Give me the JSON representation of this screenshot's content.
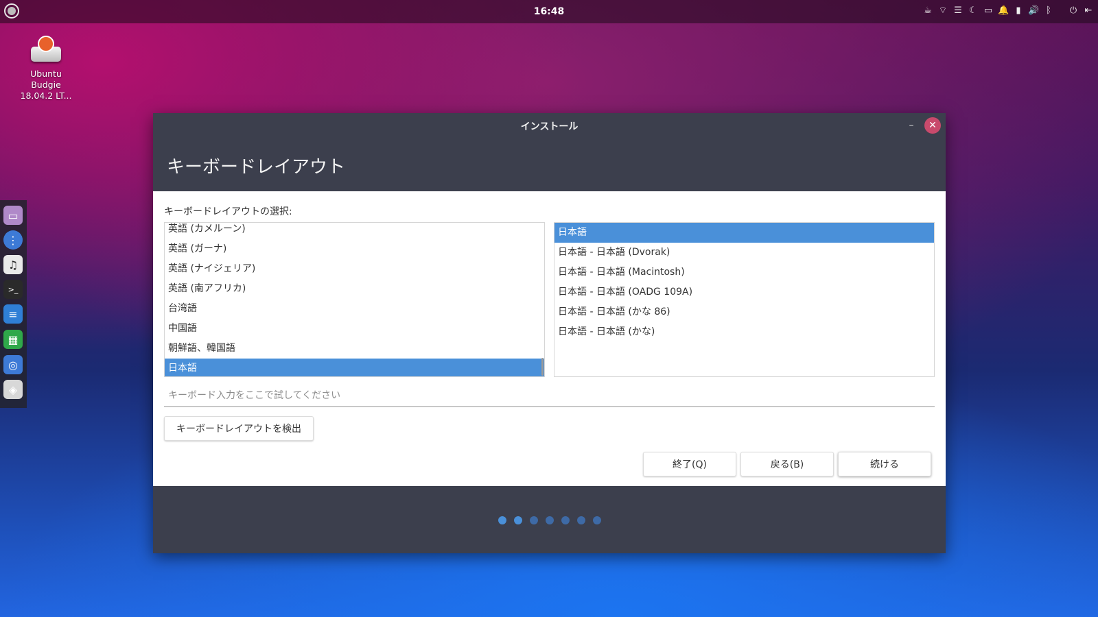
{
  "topbar": {
    "clock": "16:48",
    "tray_icons": [
      "coffee-icon",
      "wifi-icon",
      "menu-icon",
      "night-light-icon",
      "folder-icon",
      "notification-icon",
      "battery-icon",
      "volume-icon",
      "bluetooth-icon",
      "power-icon",
      "logout-icon"
    ]
  },
  "desktop": {
    "icon_label_line1": "Ubuntu",
    "icon_label_line2": "Budgie",
    "icon_label_line3": "18.04.2 LT..."
  },
  "dock": {
    "items": [
      "files-icon",
      "app-menu-icon",
      "music-icon",
      "terminal-icon",
      "writer-icon",
      "calc-icon",
      "chrome-icon",
      "installer-icon"
    ]
  },
  "window": {
    "title": "インストール",
    "heading": "キーボードレイアウト",
    "prompt": "キーボードレイアウトの選択:",
    "languages": [
      "英語 (カメルーン)",
      "英語 (ガーナ)",
      "英語 (ナイジェリア)",
      "英語 (南アフリカ)",
      "台湾語",
      "中国語",
      "朝鮮語、韓国語",
      "日本語"
    ],
    "variants": [
      "日本語",
      "日本語 - 日本語 (Dvorak)",
      "日本語 - 日本語 (Macintosh)",
      "日本語 - 日本語 (OADG 109A)",
      "日本語 - 日本語 (かな 86)",
      "日本語 - 日本語 (かな)"
    ],
    "test_placeholder": "キーボード入力をここで試してください",
    "detect_label": "キーボードレイアウトを検出",
    "quit_label": "終了(Q)",
    "back_label": "戻る(B)",
    "continue_label": "続ける",
    "progress_steps": 7,
    "progress_current": 2
  },
  "colors": {
    "selection": "#4a90d9",
    "close_button": "#c84a6c",
    "window_header": "#3c3f4d"
  }
}
